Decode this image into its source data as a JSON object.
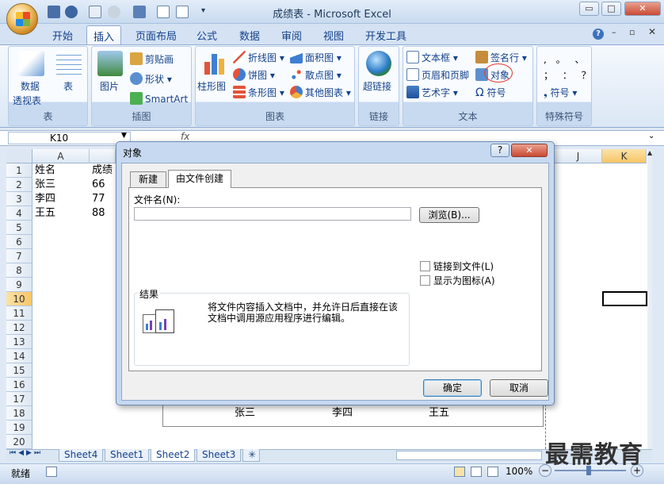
{
  "window": {
    "title": "成绩表 - Microsoft Excel",
    "min": "▭",
    "max": "□",
    "close": "✕"
  },
  "tabs": [
    "开始",
    "插入",
    "页面布局",
    "公式",
    "数据",
    "审阅",
    "视图",
    "开发工具"
  ],
  "ribbon": {
    "tables_group": {
      "label": "表",
      "pivot": "数据",
      "pivot2": "透视表",
      "table": "表"
    },
    "illus_group": {
      "label": "插图",
      "picture": "图片",
      "clipart": "剪贴画",
      "shapes": "形状",
      "smartart": "SmartArt"
    },
    "charts_group": {
      "label": "图表",
      "column": "柱形图",
      "line": "折线图",
      "pie": "饼图",
      "bar": "条形图",
      "area": "面积图",
      "scatter": "散点图",
      "other": "其他图表"
    },
    "links_group": {
      "label": "链接",
      "hyperlink": "超链接"
    },
    "text_group": {
      "label": "文本",
      "textbox": "文本框",
      "header_footer": "页眉和页脚",
      "wordart": "艺术字",
      "signature": "签名行",
      "object": "对象",
      "symbol": "符号"
    },
    "special_group": {
      "label": "特殊符号",
      "symbol": "符号",
      "row1": ", 。 、",
      "row2": "； ： ？"
    }
  },
  "formula_bar": {
    "name_box": "K10",
    "fx": "fx"
  },
  "columns": [
    "A",
    "J",
    "K"
  ],
  "rows": [
    "1",
    "2",
    "3",
    "4",
    "5",
    "6",
    "7",
    "8",
    "9",
    "10",
    "11",
    "12",
    "13",
    "14",
    "15",
    "16",
    "17",
    "18",
    "19",
    "20"
  ],
  "cells": {
    "a1": "姓名",
    "b1": "成绩",
    "a2": "张三",
    "b2": "66",
    "a3": "李四",
    "b3": "77",
    "a4": "王五",
    "b4": "88"
  },
  "chart_labels": [
    "张三",
    "李四",
    "王五"
  ],
  "sheets": [
    "Sheet4",
    "Sheet1",
    "Sheet2",
    "Sheet3"
  ],
  "status": {
    "ready": "就绪",
    "zoom": "100%"
  },
  "dialog": {
    "title": "对象",
    "help": "?",
    "close": "✕",
    "tab_new": "新建",
    "tab_from_file": "由文件创建",
    "filename_label": "文件名(N):",
    "filename_value": "",
    "browse": "浏览(B)...",
    "link_to_file": "链接到文件(L)",
    "display_as_icon": "显示为图标(A)",
    "result_label": "结果",
    "result_text": "将文件内容插入文档中，并允许日后直接在该文档中调用源应用程序进行编辑。",
    "ok": "确定",
    "cancel": "取消"
  },
  "watermark": "最需教育"
}
